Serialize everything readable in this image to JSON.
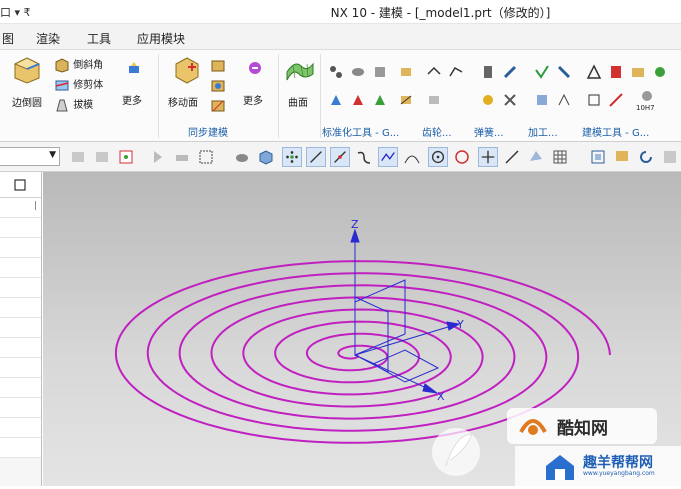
{
  "window": {
    "menu_stub": "口 ▾ ₹",
    "title": "NX 10 - 建模 - [_model1.prt（修改的）]"
  },
  "menubar": {
    "items": [
      "图",
      "渲染",
      "工具",
      "应用模块"
    ]
  },
  "ribbon": {
    "edge_blend": "边倒圆",
    "chamfer": "倒斜角",
    "trim_body": "修剪体",
    "draft": "拔模",
    "more1": "更多",
    "move_face": "移动面",
    "more2": "更多",
    "surface": "曲面",
    "groups": {
      "sync": "同步建模",
      "std_tools": "标准化工具 - G...",
      "gear": "齿轮...",
      "spring": "弹簧...",
      "machining": "加工...",
      "build_tools": "建模工具 - G..."
    },
    "tiny_label": "10H7"
  },
  "watermarks": {
    "brand1": "酷知网",
    "brand2": "趣羊帮帮网",
    "brand2_url": "www.yueyangbang.com"
  },
  "viewport": {
    "axis_z": "Z",
    "axis_y": "Y",
    "axis_x": "X",
    "accent": "#c020c0",
    "axis_color": "#2a2ad0"
  }
}
